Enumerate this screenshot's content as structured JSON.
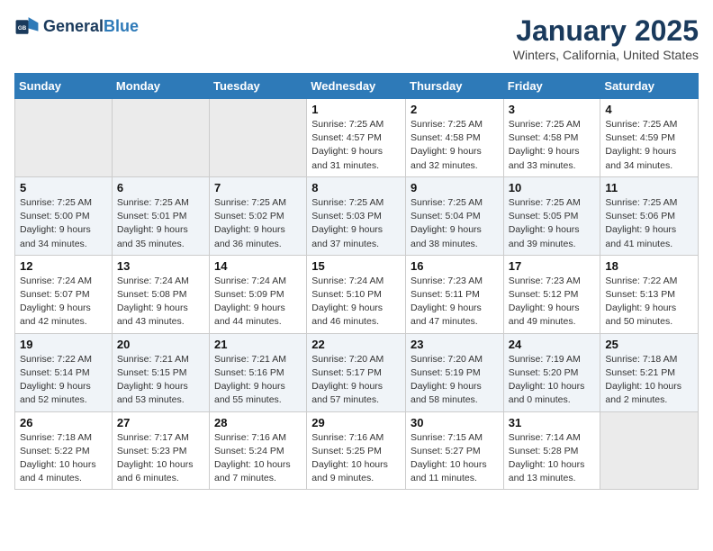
{
  "logo": {
    "line1": "General",
    "line2": "Blue"
  },
  "title": "January 2025",
  "subtitle": "Winters, California, United States",
  "days_of_week": [
    "Sunday",
    "Monday",
    "Tuesday",
    "Wednesday",
    "Thursday",
    "Friday",
    "Saturday"
  ],
  "weeks": [
    [
      {
        "day": "",
        "info": ""
      },
      {
        "day": "",
        "info": ""
      },
      {
        "day": "",
        "info": ""
      },
      {
        "day": "1",
        "info": "Sunrise: 7:25 AM\nSunset: 4:57 PM\nDaylight: 9 hours\nand 31 minutes."
      },
      {
        "day": "2",
        "info": "Sunrise: 7:25 AM\nSunset: 4:58 PM\nDaylight: 9 hours\nand 32 minutes."
      },
      {
        "day": "3",
        "info": "Sunrise: 7:25 AM\nSunset: 4:58 PM\nDaylight: 9 hours\nand 33 minutes."
      },
      {
        "day": "4",
        "info": "Sunrise: 7:25 AM\nSunset: 4:59 PM\nDaylight: 9 hours\nand 34 minutes."
      }
    ],
    [
      {
        "day": "5",
        "info": "Sunrise: 7:25 AM\nSunset: 5:00 PM\nDaylight: 9 hours\nand 34 minutes."
      },
      {
        "day": "6",
        "info": "Sunrise: 7:25 AM\nSunset: 5:01 PM\nDaylight: 9 hours\nand 35 minutes."
      },
      {
        "day": "7",
        "info": "Sunrise: 7:25 AM\nSunset: 5:02 PM\nDaylight: 9 hours\nand 36 minutes."
      },
      {
        "day": "8",
        "info": "Sunrise: 7:25 AM\nSunset: 5:03 PM\nDaylight: 9 hours\nand 37 minutes."
      },
      {
        "day": "9",
        "info": "Sunrise: 7:25 AM\nSunset: 5:04 PM\nDaylight: 9 hours\nand 38 minutes."
      },
      {
        "day": "10",
        "info": "Sunrise: 7:25 AM\nSunset: 5:05 PM\nDaylight: 9 hours\nand 39 minutes."
      },
      {
        "day": "11",
        "info": "Sunrise: 7:25 AM\nSunset: 5:06 PM\nDaylight: 9 hours\nand 41 minutes."
      }
    ],
    [
      {
        "day": "12",
        "info": "Sunrise: 7:24 AM\nSunset: 5:07 PM\nDaylight: 9 hours\nand 42 minutes."
      },
      {
        "day": "13",
        "info": "Sunrise: 7:24 AM\nSunset: 5:08 PM\nDaylight: 9 hours\nand 43 minutes."
      },
      {
        "day": "14",
        "info": "Sunrise: 7:24 AM\nSunset: 5:09 PM\nDaylight: 9 hours\nand 44 minutes."
      },
      {
        "day": "15",
        "info": "Sunrise: 7:24 AM\nSunset: 5:10 PM\nDaylight: 9 hours\nand 46 minutes."
      },
      {
        "day": "16",
        "info": "Sunrise: 7:23 AM\nSunset: 5:11 PM\nDaylight: 9 hours\nand 47 minutes."
      },
      {
        "day": "17",
        "info": "Sunrise: 7:23 AM\nSunset: 5:12 PM\nDaylight: 9 hours\nand 49 minutes."
      },
      {
        "day": "18",
        "info": "Sunrise: 7:22 AM\nSunset: 5:13 PM\nDaylight: 9 hours\nand 50 minutes."
      }
    ],
    [
      {
        "day": "19",
        "info": "Sunrise: 7:22 AM\nSunset: 5:14 PM\nDaylight: 9 hours\nand 52 minutes."
      },
      {
        "day": "20",
        "info": "Sunrise: 7:21 AM\nSunset: 5:15 PM\nDaylight: 9 hours\nand 53 minutes."
      },
      {
        "day": "21",
        "info": "Sunrise: 7:21 AM\nSunset: 5:16 PM\nDaylight: 9 hours\nand 55 minutes."
      },
      {
        "day": "22",
        "info": "Sunrise: 7:20 AM\nSunset: 5:17 PM\nDaylight: 9 hours\nand 57 minutes."
      },
      {
        "day": "23",
        "info": "Sunrise: 7:20 AM\nSunset: 5:19 PM\nDaylight: 9 hours\nand 58 minutes."
      },
      {
        "day": "24",
        "info": "Sunrise: 7:19 AM\nSunset: 5:20 PM\nDaylight: 10 hours\nand 0 minutes."
      },
      {
        "day": "25",
        "info": "Sunrise: 7:18 AM\nSunset: 5:21 PM\nDaylight: 10 hours\nand 2 minutes."
      }
    ],
    [
      {
        "day": "26",
        "info": "Sunrise: 7:18 AM\nSunset: 5:22 PM\nDaylight: 10 hours\nand 4 minutes."
      },
      {
        "day": "27",
        "info": "Sunrise: 7:17 AM\nSunset: 5:23 PM\nDaylight: 10 hours\nand 6 minutes."
      },
      {
        "day": "28",
        "info": "Sunrise: 7:16 AM\nSunset: 5:24 PM\nDaylight: 10 hours\nand 7 minutes."
      },
      {
        "day": "29",
        "info": "Sunrise: 7:16 AM\nSunset: 5:25 PM\nDaylight: 10 hours\nand 9 minutes."
      },
      {
        "day": "30",
        "info": "Sunrise: 7:15 AM\nSunset: 5:27 PM\nDaylight: 10 hours\nand 11 minutes."
      },
      {
        "day": "31",
        "info": "Sunrise: 7:14 AM\nSunset: 5:28 PM\nDaylight: 10 hours\nand 13 minutes."
      },
      {
        "day": "",
        "info": ""
      }
    ]
  ]
}
